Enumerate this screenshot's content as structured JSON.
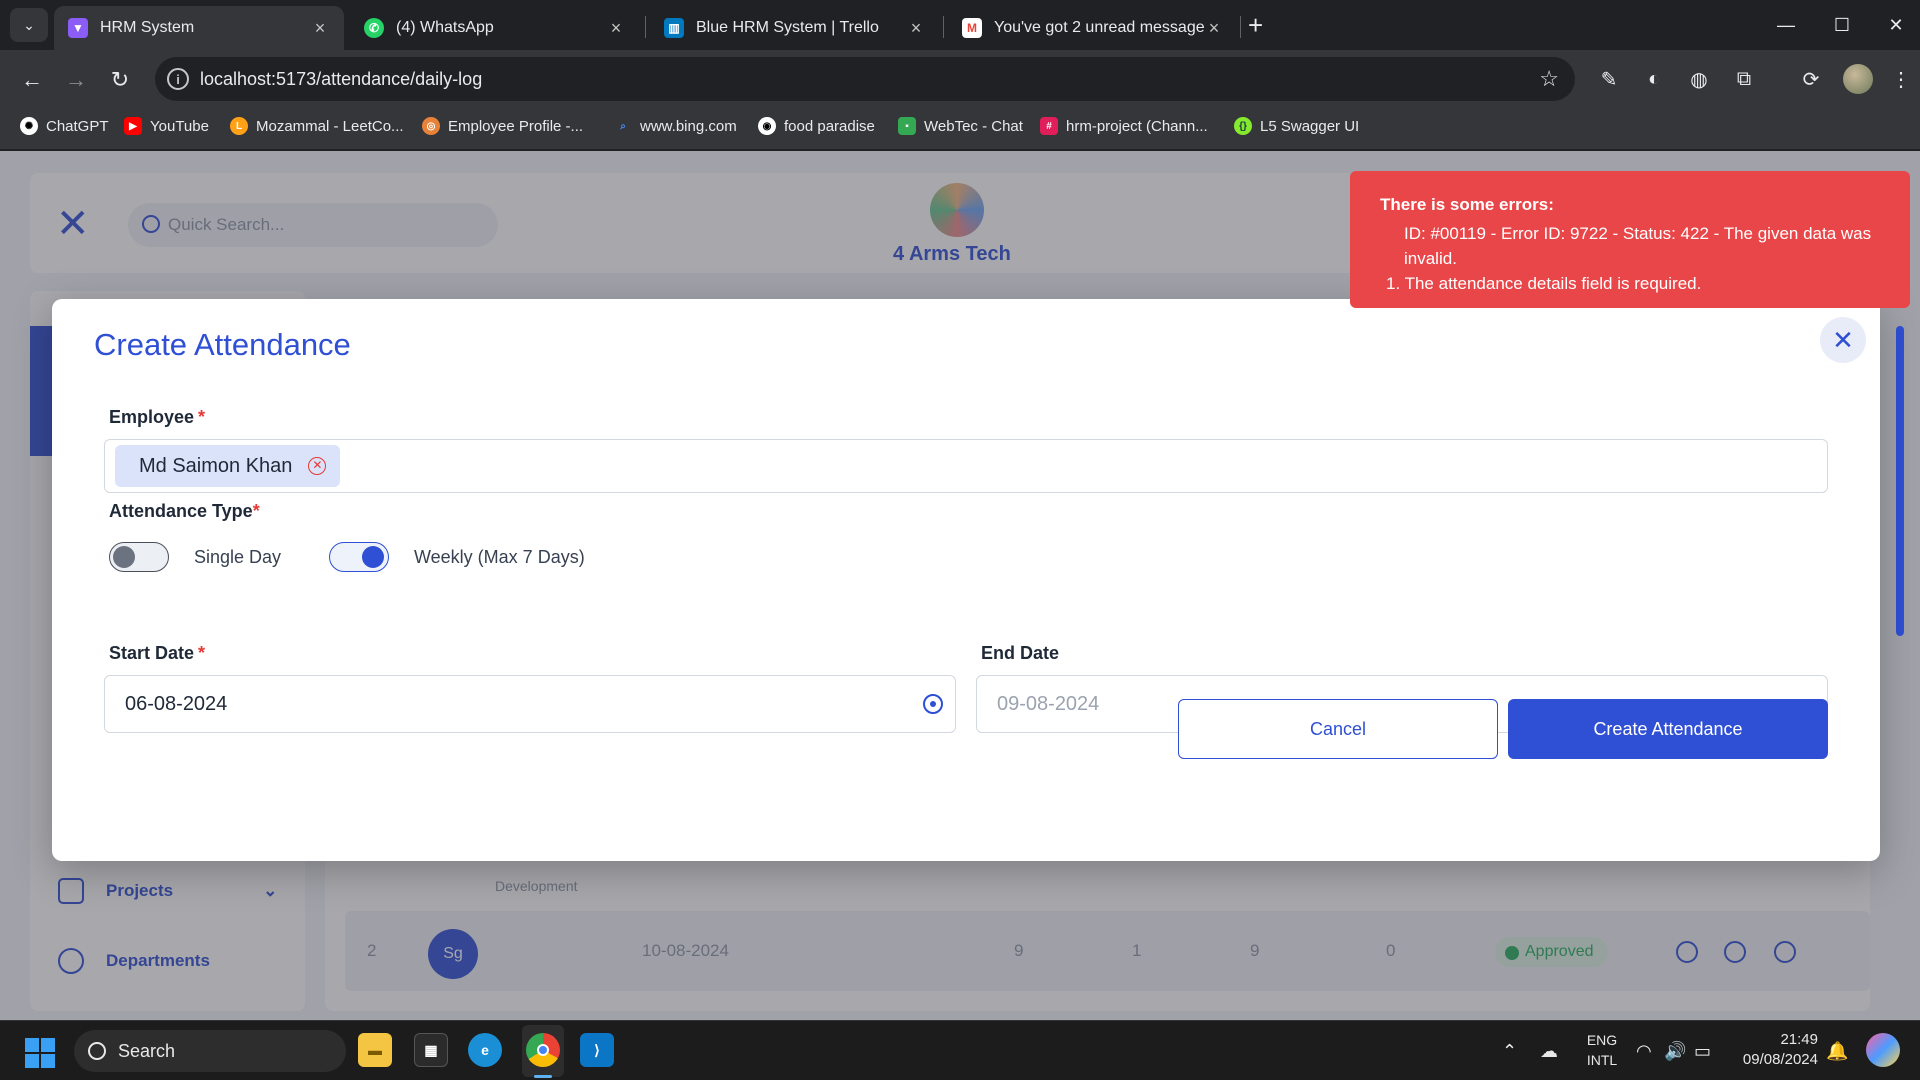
{
  "browser": {
    "tabs": [
      {
        "title": "HRM System",
        "icon": "vite-icon",
        "color": "#8b5cf6"
      },
      {
        "title": "(4) WhatsApp",
        "icon": "whatsapp-icon",
        "color": "#25d366"
      },
      {
        "title": "Blue HRM System | Trello",
        "icon": "trello-icon",
        "color": "#0079bf"
      },
      {
        "title": "You've got 2 unread messages",
        "icon": "gmail-icon",
        "color": "#ea4335"
      }
    ],
    "url": "localhost:5173/attendance/daily-log",
    "bookmarks": [
      {
        "label": "ChatGPT",
        "icon": "chatgpt-icon",
        "color": "#ffffff"
      },
      {
        "label": "YouTube",
        "icon": "youtube-icon",
        "color": "#ff0000"
      },
      {
        "label": "Mozammal - LeetCo...",
        "icon": "leetcode-icon",
        "color": "#ffa116"
      },
      {
        "label": "Employee Profile -...",
        "icon": "profile-icon",
        "color": "#e8823a"
      },
      {
        "label": "www.bing.com",
        "icon": "search-icon",
        "color": "#4a8af4"
      },
      {
        "label": "food paradise",
        "icon": "github-icon",
        "color": "#ffffff"
      },
      {
        "label": "WebTec - Chat",
        "icon": "chat-icon",
        "color": "#34a853"
      },
      {
        "label": "hrm-project (Chann...",
        "icon": "slack-icon",
        "color": "#e01e5a"
      },
      {
        "label": "L5 Swagger UI",
        "icon": "swagger-icon",
        "color": "#85ea2d"
      }
    ]
  },
  "background": {
    "search_placeholder": "Quick Search...",
    "brand": "4 Arms Tech",
    "nav": [
      "Projects",
      "Departments"
    ],
    "table_row": {
      "index": "2",
      "avatar": "Sg",
      "date": "10-08-2024",
      "values": [
        "9",
        "1",
        "9",
        "0"
      ],
      "status": "Approved",
      "dept": "Development"
    }
  },
  "modal": {
    "title": "Create Attendance",
    "employee_label": "Employee",
    "employee_value": "Md Saimon Khan",
    "attendance_type_label": "Attendance Type",
    "option_single": "Single Day",
    "option_weekly": "Weekly (Max 7 Days)",
    "single_on": false,
    "weekly_on": true,
    "start_date_label": "Start Date",
    "start_date_value": "06-08-2024",
    "end_date_label": "End Date",
    "end_date_value": "09-08-2024",
    "cancel_label": "Cancel",
    "submit_label": "Create Attendance",
    "required_mark": "*"
  },
  "toast": {
    "title": "There is some errors:",
    "line1": "ID: #00119 - Error ID: 9722 - Status: 422 - The given data was invalid.",
    "item1": "1. The attendance details field is required."
  },
  "taskbar": {
    "search_label": "Search",
    "lang_1": "ENG",
    "lang_2": "INTL",
    "time": "21:49",
    "date": "09/08/2024"
  },
  "colors": {
    "accent": "#2f4fd4",
    "error": "#e94649"
  }
}
